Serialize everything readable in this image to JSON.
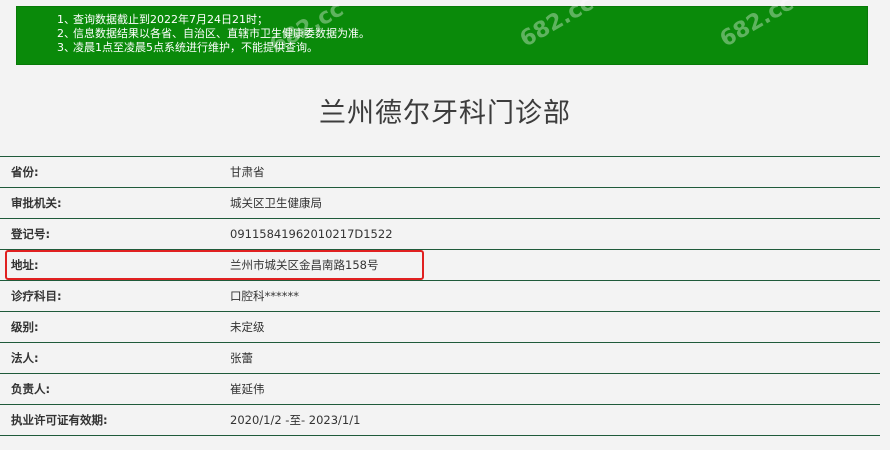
{
  "notice": {
    "items": [
      {
        "num": "1、",
        "text": "查询数据截止到2022年7月24日21时；"
      },
      {
        "num": "2、",
        "text": "信息数据结果以各省、自治区、直辖市卫生健康委数据为准。"
      },
      {
        "num": "3、",
        "text": "凌晨1点至凌晨5点系统进行维护，不能提供查询。"
      }
    ],
    "background": "#0a8a0a"
  },
  "title": "兰州德尔牙科门诊部",
  "rows": [
    {
      "label": "省份:",
      "value": "甘肃省"
    },
    {
      "label": "审批机关:",
      "value": "城关区卫生健康局"
    },
    {
      "label": "登记号:",
      "value": "09115841962010217D1522"
    },
    {
      "label": "地址:",
      "value": "兰州市城关区金昌南路158号"
    },
    {
      "label": "诊疗科目:",
      "value": "口腔科******"
    },
    {
      "label": "级别:",
      "value": "未定级"
    },
    {
      "label": "法人:",
      "value": "张蕾"
    },
    {
      "label": "负责人:",
      "value": "崔延伟"
    },
    {
      "label": "执业许可证有效期:",
      "value": "2020/1/2 -至- 2023/1/1"
    }
  ],
  "watermark": "682.cc",
  "highlight_color": "#e02020"
}
